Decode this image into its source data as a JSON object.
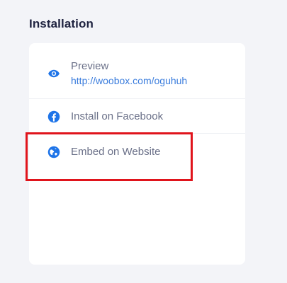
{
  "section": {
    "title": "Installation"
  },
  "items": [
    {
      "label": "Preview",
      "link": "http://woobox.com/oguhuh",
      "icon": "eye-icon"
    },
    {
      "label": "Install on Facebook",
      "icon": "facebook-icon"
    },
    {
      "label": "Embed on Website",
      "icon": "globe-icon"
    }
  ],
  "colors": {
    "accent": "#1e74e8",
    "link": "#3b7ddd",
    "highlight": "#e0141c",
    "background": "#f3f4f8"
  }
}
